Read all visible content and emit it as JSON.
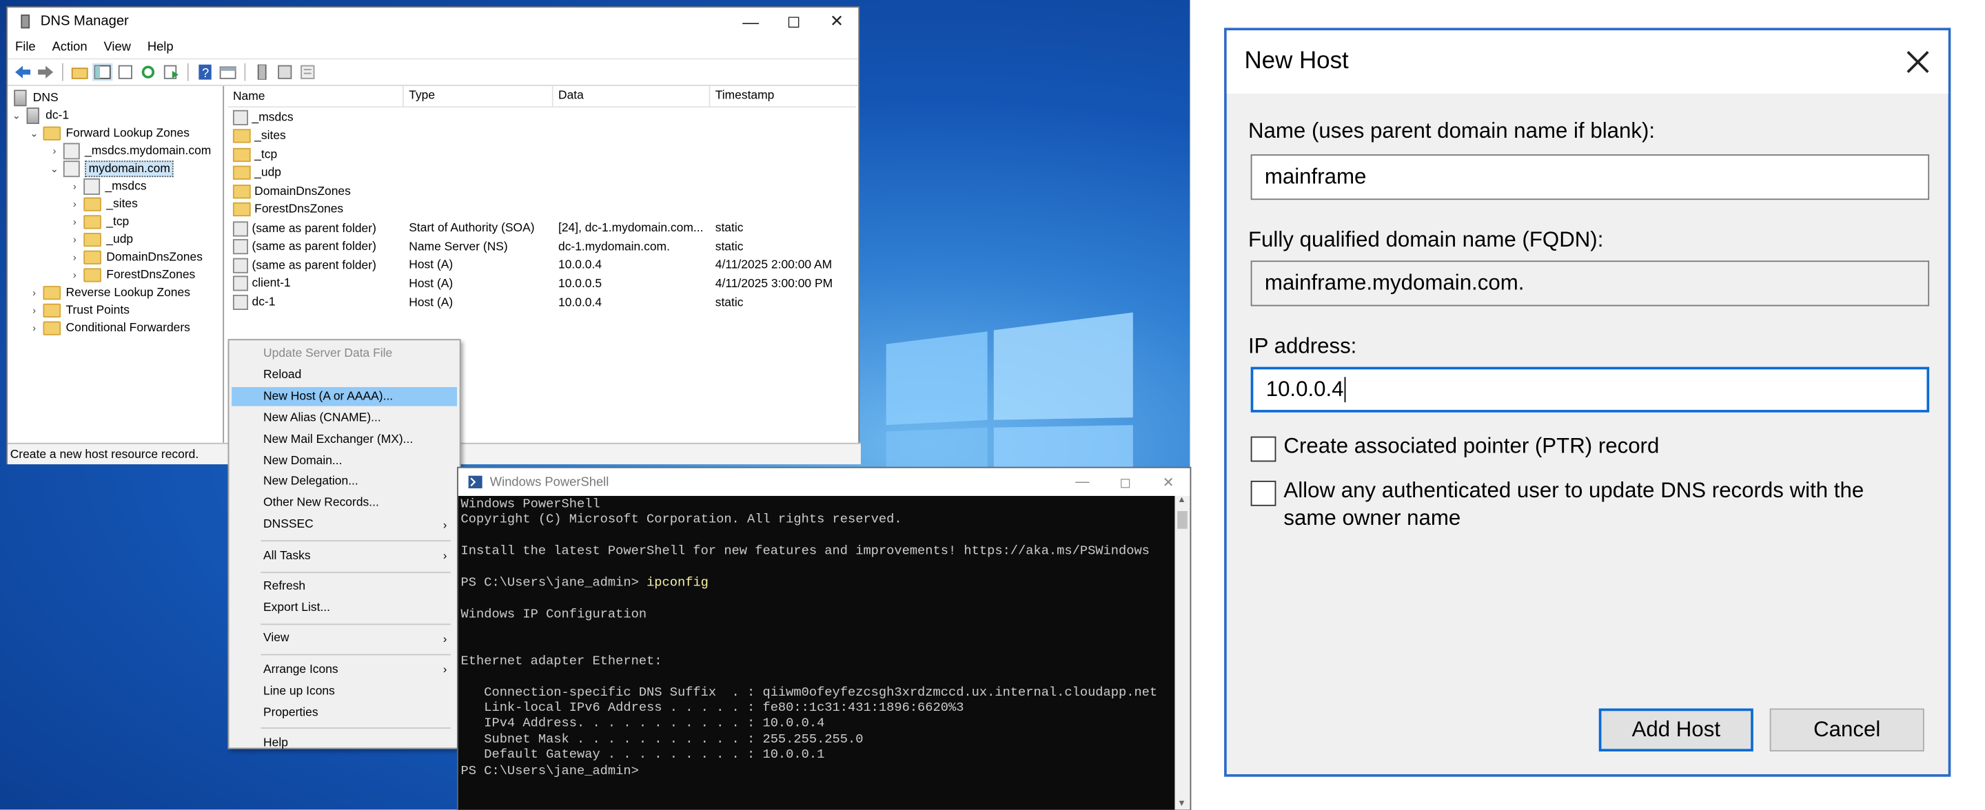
{
  "dns_manager": {
    "title": "DNS Manager",
    "menu": [
      "File",
      "Action",
      "View",
      "Help"
    ],
    "tree": [
      {
        "label": "DNS",
        "depth": 0,
        "icon": "dns-icon"
      },
      {
        "label": "dc-1",
        "depth": 1,
        "icon": "server-icon"
      },
      {
        "label": "Forward Lookup Zones",
        "depth": 2,
        "icon": "folder-icon"
      },
      {
        "label": "_msdcs.mydomain.com",
        "depth": 3,
        "icon": "zone-icon"
      },
      {
        "label": "mydomain.com",
        "depth": 3,
        "icon": "zone-icon",
        "selected": true
      },
      {
        "label": "_msdcs",
        "depth": 4,
        "icon": "folder-icon"
      },
      {
        "label": "_sites",
        "depth": 4,
        "icon": "folder-icon"
      },
      {
        "label": "_tcp",
        "depth": 4,
        "icon": "folder-icon"
      },
      {
        "label": "_udp",
        "depth": 4,
        "icon": "folder-icon"
      },
      {
        "label": "DomainDnsZones",
        "depth": 4,
        "icon": "folder-icon"
      },
      {
        "label": "ForestDnsZones",
        "depth": 4,
        "icon": "folder-icon"
      },
      {
        "label": "Reverse Lookup Zones",
        "depth": 2,
        "icon": "folder-icon"
      },
      {
        "label": "Trust Points",
        "depth": 2,
        "icon": "folder-icon"
      },
      {
        "label": "Conditional Forwarders",
        "depth": 2,
        "icon": "folder-icon"
      }
    ],
    "columns": [
      "Name",
      "Type",
      "Data",
      "Timestamp"
    ],
    "rows": [
      {
        "name": "_msdcs",
        "type": "",
        "data": "",
        "timestamp": "",
        "icon": "zone-icon"
      },
      {
        "name": "_sites",
        "type": "",
        "data": "",
        "timestamp": "",
        "icon": "folder-icon"
      },
      {
        "name": "_tcp",
        "type": "",
        "data": "",
        "timestamp": "",
        "icon": "folder-icon"
      },
      {
        "name": "_udp",
        "type": "",
        "data": "",
        "timestamp": "",
        "icon": "folder-icon"
      },
      {
        "name": "DomainDnsZones",
        "type": "",
        "data": "",
        "timestamp": "",
        "icon": "folder-icon"
      },
      {
        "name": "ForestDnsZones",
        "type": "",
        "data": "",
        "timestamp": "",
        "icon": "folder-icon"
      },
      {
        "name": "(same as parent folder)",
        "type": "Start of Authority (SOA)",
        "data": "[24], dc-1.mydomain.com...",
        "timestamp": "static",
        "icon": "record-icon"
      },
      {
        "name": "(same as parent folder)",
        "type": "Name Server (NS)",
        "data": "dc-1.mydomain.com.",
        "timestamp": "static",
        "icon": "record-icon"
      },
      {
        "name": "(same as parent folder)",
        "type": "Host (A)",
        "data": "10.0.0.4",
        "timestamp": "4/11/2025 2:00:00 AM",
        "icon": "record-icon"
      },
      {
        "name": "client-1",
        "type": "Host (A)",
        "data": "10.0.0.5",
        "timestamp": "4/11/2025 3:00:00 PM",
        "icon": "record-icon"
      },
      {
        "name": "dc-1",
        "type": "Host (A)",
        "data": "10.0.0.4",
        "timestamp": "static",
        "icon": "record-icon"
      }
    ],
    "status": "Create a new host resource record."
  },
  "context_menu": {
    "items": [
      {
        "label": "Update Server Data File",
        "disabled": true
      },
      {
        "label": "Reload"
      },
      {
        "label": "New Host (A or AAAA)...",
        "highlighted": true
      },
      {
        "label": "New Alias (CNAME)..."
      },
      {
        "label": "New Mail Exchanger (MX)..."
      },
      {
        "label": "New Domain..."
      },
      {
        "label": "New Delegation..."
      },
      {
        "label": "Other New Records..."
      },
      {
        "label": "DNSSEC",
        "submenu": true
      },
      {
        "separator": true
      },
      {
        "label": "All Tasks",
        "submenu": true
      },
      {
        "separator": true
      },
      {
        "label": "Refresh"
      },
      {
        "label": "Export List..."
      },
      {
        "separator": true
      },
      {
        "label": "View",
        "submenu": true
      },
      {
        "separator": true
      },
      {
        "label": "Arrange Icons",
        "submenu": true
      },
      {
        "label": "Line up Icons"
      },
      {
        "label": "Properties"
      },
      {
        "separator": true
      },
      {
        "label": "Help"
      }
    ]
  },
  "powershell": {
    "title": "Windows PowerShell",
    "lines": [
      {
        "text": "Windows PowerShell"
      },
      {
        "text": "Copyright (C) Microsoft Corporation. All rights reserved."
      },
      {
        "text": ""
      },
      {
        "text": "Install the latest PowerShell for new features and improvements! https://aka.ms/PSWindows"
      },
      {
        "text": ""
      },
      {
        "text": "PS C:\\Users\\jane_admin> ",
        "cmd": "ipconfig"
      },
      {
        "text": ""
      },
      {
        "text": "Windows IP Configuration"
      },
      {
        "text": ""
      },
      {
        "text": ""
      },
      {
        "text": "Ethernet adapter Ethernet:"
      },
      {
        "text": ""
      },
      {
        "text": "   Connection-specific DNS Suffix  . : qiiwm0ofeyfezcsgh3xrdzmccd.ux.internal.cloudapp.net"
      },
      {
        "text": "   Link-local IPv6 Address . . . . . : fe80::1c31:431:1896:6620%3"
      },
      {
        "text": "   IPv4 Address. . . . . . . . . . . : 10.0.0.4"
      },
      {
        "text": "   Subnet Mask . . . . . . . . . . . : 255.255.255.0"
      },
      {
        "text": "   Default Gateway . . . . . . . . . : 10.0.0.1"
      },
      {
        "text": "PS C:\\Users\\jane_admin>"
      }
    ]
  },
  "new_host_dialog": {
    "title": "New Host",
    "name_label": "Name (uses parent domain name if blank):",
    "name_value": "mainframe",
    "fqdn_label": "Fully qualified domain name (FQDN):",
    "fqdn_value": "mainframe.mydomain.com.",
    "ip_label": "IP address:",
    "ip_value": "10.0.0.4",
    "ptr_label": "Create associated pointer (PTR) record",
    "ptr_checked": false,
    "auth_label_1": "Allow any authenticated user to update DNS records with the",
    "auth_label_2": "same owner name",
    "auth_checked": false,
    "add_button": "Add Host",
    "cancel_button": "Cancel"
  },
  "colors": {
    "accent": "#0b6bd3",
    "menu_highlight": "#91c9f7",
    "console_bg": "#0c0c0c",
    "console_cmd": "#f9f1a5"
  }
}
